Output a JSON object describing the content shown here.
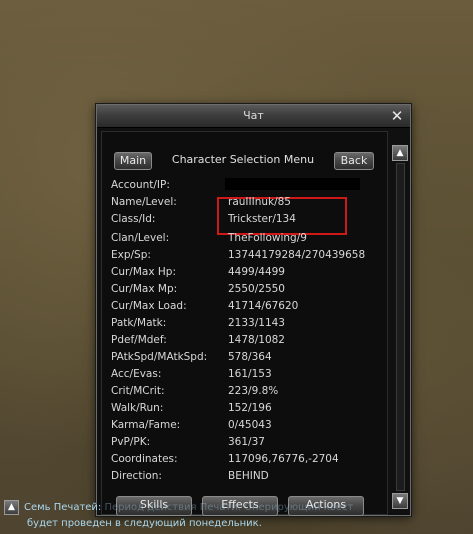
{
  "window": {
    "title": "Чат",
    "close_glyph": "✕"
  },
  "menu": {
    "main_label": "Main",
    "title": "Character Selection Menu",
    "back_label": "Back"
  },
  "info": {
    "rows": [
      {
        "label": "Account/IP:",
        "value": ""
      },
      {
        "label": "Name/Level:",
        "value": "rauIIInuk/85"
      },
      {
        "label": "Class/Id:",
        "value": "Trickster/134"
      },
      {
        "label": "Clan/Level:",
        "value": "TheFollowing/9"
      },
      {
        "label": "Exp/Sp:",
        "value": "13744179284/270439658"
      },
      {
        "label": "Cur/Max Hp:",
        "value": "4499/4499"
      },
      {
        "label": "Cur/Max Mp:",
        "value": "2550/2550"
      },
      {
        "label": "Cur/Max Load:",
        "value": "41714/67620"
      },
      {
        "label": "Patk/Matk:",
        "value": "2133/1143"
      },
      {
        "label": "Pdef/Mdef:",
        "value": "1478/1082"
      },
      {
        "label": "PAtkSpd/MAtkSpd:",
        "value": "578/364"
      },
      {
        "label": "Acc/Evas:",
        "value": "161/153"
      },
      {
        "label": "Crit/MCrit:",
        "value": "223/9.8%"
      },
      {
        "label": "Walk/Run:",
        "value": "152/196"
      },
      {
        "label": "Karma/Fame:",
        "value": "0/45043"
      },
      {
        "label": "PvP/PK:",
        "value": "361/37"
      },
      {
        "label": "Coordinates:",
        "value": "117096,76776,-2704"
      },
      {
        "label": "Direction:",
        "value": "BEHIND"
      }
    ]
  },
  "bottom_buttons": {
    "skills": "Skills",
    "effects": "Effects",
    "actions": "Actions"
  },
  "scrollbar": {
    "up_glyph": "▲",
    "down_glyph": "▼"
  },
  "chat": {
    "icon_glyph": "▲",
    "line1": "Семь Печатей:",
    "line1_faded": " Период действия Печати. Оперирующий квест",
    "line2": "будет проведен в следующий понедельник."
  },
  "colors": {
    "highlight": "#d01818",
    "chat_text": "#a9d7ee"
  }
}
